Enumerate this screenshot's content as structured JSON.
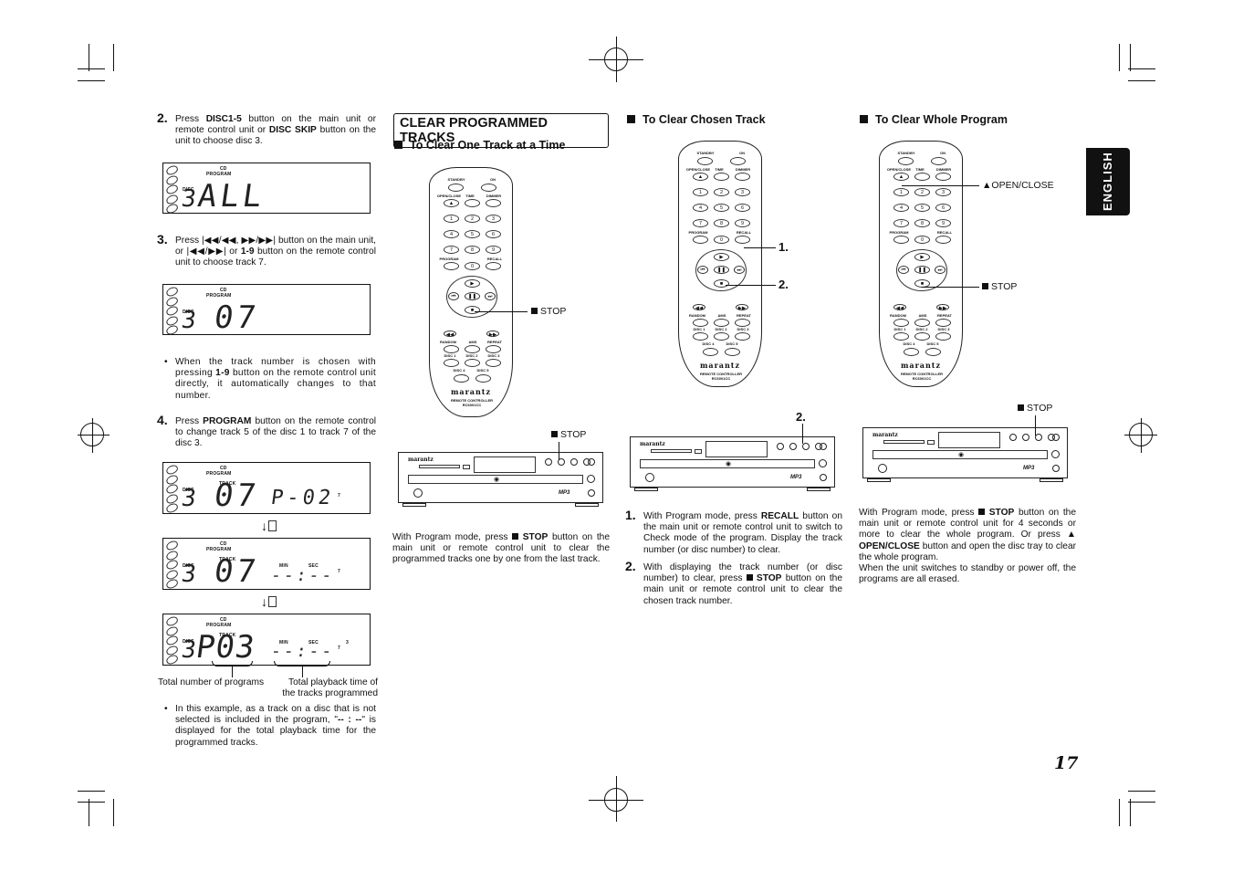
{
  "page": {
    "number": "17",
    "language_tab": "ENGLISH"
  },
  "left_column": {
    "step2": {
      "num": "2.",
      "text_pre": "Press ",
      "bold1": "DISC1-5",
      "text_mid": " button on the main unit or remote control unit or ",
      "bold2": "DISC SKIP",
      "text_post": " button on the unit to choose disc 3."
    },
    "step3": {
      "num": "3.",
      "text": "Press |◀◀/◀◀, ▶▶/▶▶| button on the main unit, or |◀◀/▶▶| or ",
      "bold": "1-9",
      "text_post": " button on the remote control unit to choose track 7."
    },
    "note1": {
      "bullet": "•",
      "pre": "When the track number is chosen with pressing ",
      "bold": "1-9",
      "post": " button on the remote control unit directly, it automatically changes to that number."
    },
    "step4": {
      "num": "4.",
      "pre": "Press ",
      "bold": "PROGRAM",
      "post": " button on the remote control to change track 5 of the disc 1 to track 7 of the disc 3."
    },
    "displays": [
      {
        "cd": "CD",
        "program": "PROGRAM",
        "disc_label": "DISC",
        "disc": "3",
        "main": "ALL"
      },
      {
        "cd": "CD",
        "program": "PROGRAM",
        "disc_label": "DISC",
        "disc": "3",
        "main": "07"
      },
      {
        "cd": "CD",
        "program": "PROGRAM",
        "track_label": "TRACK",
        "disc_label": "DISC",
        "disc": "3",
        "main": "07",
        "right": "P-02",
        "small": "7"
      },
      {
        "cd": "CD",
        "program": "PROGRAM",
        "track_label": "TRACK",
        "disc_label": "DISC",
        "disc": "3",
        "main": "07",
        "min": "MIN",
        "sec": "SEC",
        "right": "--:--",
        "small": "7"
      },
      {
        "cd": "CD",
        "program": "PROGRAM",
        "track_label": "TRACK",
        "disc_label": "DISC",
        "disc": "3",
        "main": "P03",
        "min": "MIN",
        "sec": "SEC",
        "right": "--:--",
        "small": "7",
        "small2": "3"
      }
    ],
    "arrow": "↓",
    "caption_left": "Total number of programs",
    "caption_right": "Total playback time of the tracks programmed",
    "note2": {
      "bullet": "•",
      "pre": "In this example, as a track on a disc that is not selected is included in the program, \"",
      "bold": "-- : --",
      "post": "\" is displayed for the total playback time for the programmed tracks."
    }
  },
  "section": {
    "title": "CLEAR PROGRAMMED TRACKS",
    "one_track": {
      "heading": "To Clear One Track at a Time",
      "stop_callout": "STOP",
      "stop_callout_player": "STOP",
      "body_pre": "With Program mode, press ",
      "body_bold": "STOP",
      "body_post": " button on the main unit or remote control unit to clear the programmed tracks one by one from the last track."
    },
    "chosen_track": {
      "heading": "To Clear Chosen Track",
      "callout1": "1.",
      "callout2": "2.",
      "callout_player": "2.",
      "step1": {
        "num": "1.",
        "pre": "With Program mode, press ",
        "bold": "RECALL",
        "post": " button on the main unit or remote control unit to switch to Check mode of the program. Display the track number (or disc number) to clear."
      },
      "step2": {
        "num": "2.",
        "pre": "With displaying the track number (or disc number) to clear, press ",
        "bold": "STOP",
        "post": " button on the main unit or remote control unit to clear the chosen track number."
      }
    },
    "whole_program": {
      "heading": "To Clear Whole Program",
      "open_close_callout": "OPEN/CLOSE",
      "stop_callout": "STOP",
      "stop_callout_player": "STOP",
      "body_pre": "With Program mode, press ",
      "body_bold1": "STOP",
      "body_mid": " button on the main unit or remote control unit for 4 seconds or more to clear the whole program. Or press ▲ ",
      "body_bold2": "OPEN/CLOSE",
      "body_post": " button and open the disc tray to clear the whole program.",
      "body2": "When the unit switches to standby or power off, the programs are all erased."
    }
  },
  "remote": {
    "standby": "STANDBY",
    "on": "ON",
    "open_close": "OPEN/CLOSE",
    "time": "TIME",
    "dimmer": "DIMMER",
    "digits": [
      "1",
      "2",
      "3",
      "4",
      "5",
      "6",
      "7",
      "8",
      "9",
      "0"
    ],
    "program": "PROGRAM",
    "recall": "RECALL",
    "random": "RANDOM",
    "ams": "AMS",
    "repeat": "REPEAT",
    "disc1": "DISC 1",
    "disc2": "DISC 2",
    "disc3": "DISC 3",
    "disc4": "DISC 4",
    "disc5": "DISC 5",
    "brand": "marantz",
    "model_line1": "REMOTE CONTROLLER",
    "model_line2": "RC6001CC"
  },
  "player": {
    "brand": "marantz",
    "mp3": "MP3"
  }
}
